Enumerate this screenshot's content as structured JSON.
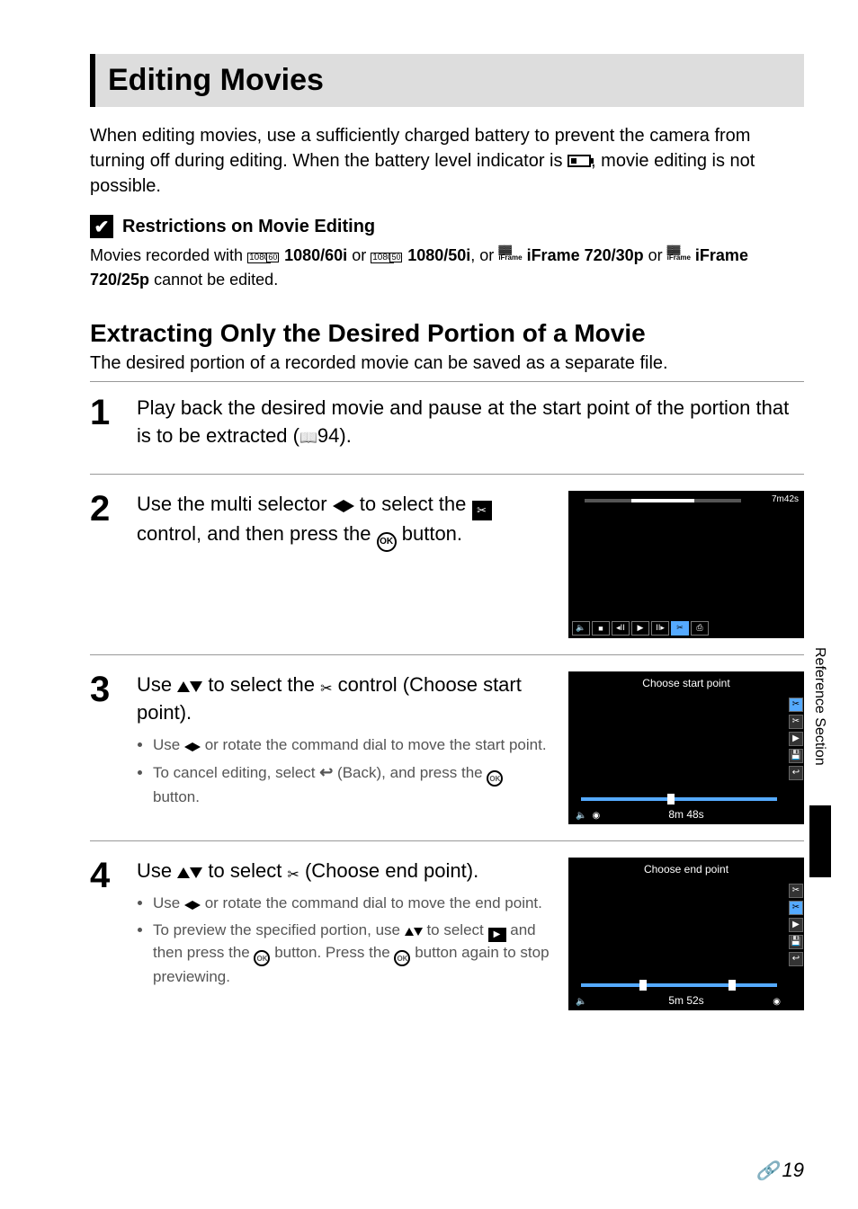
{
  "title": "Editing Movies",
  "intro_pre": "When editing movies, use a sufficiently charged battery to prevent the camera from turning off during editing. When the battery level indicator is ",
  "intro_post": ", movie editing is not possible.",
  "restrictions": {
    "heading": "Restrictions on Movie Editing",
    "pre": "Movies recorded with ",
    "fmt1": "1080/60i",
    "mid1": " or ",
    "fmt2": "1080/50i",
    "mid2": ", or ",
    "fmt3": "iFrame 720/30p",
    "mid3": " or ",
    "fmt4": "iFrame 720/25p",
    "post": " cannot be edited."
  },
  "section2": {
    "heading": "Extracting Only the Desired Portion of a Movie",
    "desc": "The desired portion of a recorded movie can be saved as a separate file."
  },
  "steps": {
    "s1": {
      "num": "1",
      "text_pre": "Play back the desired movie and pause at the start point of the portion that is to be extracted (",
      "ref": "94).",
      "text_post": ""
    },
    "s2": {
      "num": "2",
      "l1_pre": "Use the multi selector ",
      "l1_post": " to select the ",
      "l1_post2": " control, and then press the ",
      "l1_end": " button.",
      "screen_time": "7m42s"
    },
    "s3": {
      "num": "3",
      "l1_pre": "Use ",
      "l1_mid": " to select the ",
      "l1_post": " control (Choose start point).",
      "b1_pre": "Use ",
      "b1_post": " or rotate the command dial to move the start point.",
      "b2_pre": "To cancel editing, select ",
      "b2_mid": " (Back), and press the ",
      "b2_post": " button.",
      "screen_title": "Choose start point",
      "screen_time": "8m 48s"
    },
    "s4": {
      "num": "4",
      "l1_pre": "Use ",
      "l1_mid": " to select ",
      "l1_post": " (Choose end point).",
      "b1_pre": "Use ",
      "b1_post": " or rotate the command dial to move the end point.",
      "b2_pre": "To preview the specified portion, use ",
      "b2_mid": " to select ",
      "b2_mid2": " and then press the ",
      "b2_mid3": " button. Press the ",
      "b2_post": " button again to stop previewing.",
      "screen_title": "Choose end point",
      "screen_time": "5m 52s"
    }
  },
  "side_label": "Reference Section",
  "page_num": "19",
  "ok_label": "OK"
}
